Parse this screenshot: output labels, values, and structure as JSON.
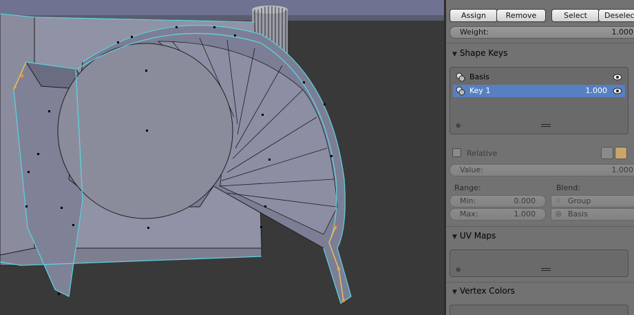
{
  "vertex_groups": {
    "assign_label": "Assign",
    "remove_label": "Remove",
    "select_label": "Select",
    "deselect_label": "Deselect",
    "weight_label": "Weight:",
    "weight_value": "1.000"
  },
  "shape_keys": {
    "title": "Shape Keys",
    "items": [
      {
        "name": "Basis",
        "value": ""
      },
      {
        "name": "Key 1",
        "value": "1.000"
      }
    ],
    "relative_label": "Relative",
    "value_label": "Value:",
    "value_value": "1.000",
    "range_label": "Range:",
    "min_label": "Min:",
    "min_value": "0.000",
    "max_label": "Max:",
    "max_value": "1.000",
    "blend_label": "Blend:",
    "blend_group": "Group",
    "blend_basis": "Basis"
  },
  "uv_maps": {
    "title": "UV Maps"
  },
  "vertex_colors": {
    "title": "Vertex Colors"
  },
  "colors": {
    "viewport_bg": "#393939",
    "panel_bg": "#727272",
    "mesh_face": "#8a8c9e",
    "mesh_edge_selected": "#5fd3e0",
    "vertex_active": "#ff8a1c",
    "list_selected": "#5680c2"
  }
}
